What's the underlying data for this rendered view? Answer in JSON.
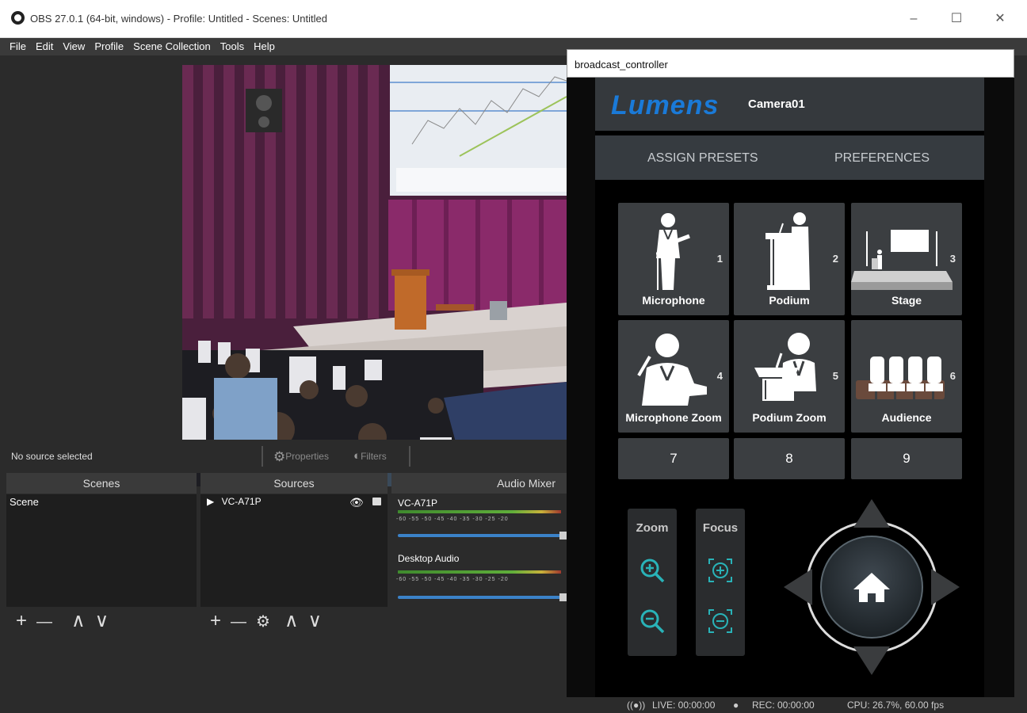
{
  "obs": {
    "title": "OBS 27.0.1 (64-bit, windows) - Profile: Untitled - Scenes: Untitled",
    "window_controls": {
      "minimize": "–",
      "maximize": "☐",
      "close": "✕"
    },
    "menu": [
      "File",
      "Edit",
      "View",
      "Profile",
      "Scene Collection",
      "Tools",
      "Help"
    ],
    "no_source": "No source selected",
    "properties": "Properties",
    "filters": "Filters",
    "docks": {
      "scenes": {
        "header": "Scenes",
        "items": [
          "Scene"
        ]
      },
      "sources": {
        "header": "Sources",
        "items": [
          "VC-A71P"
        ]
      },
      "mixer": {
        "header": "Audio Mixer",
        "channels": [
          {
            "name": "VC-A71P"
          },
          {
            "name": "Desktop Audio"
          }
        ],
        "scale": "-60 -55 -50 -45 -40 -35 -30 -25 -20"
      }
    },
    "footer_controls": {
      "add": "+",
      "remove": "—",
      "up": "∧",
      "down": "∨",
      "settings": "⚙"
    },
    "status": {
      "live": "LIVE: 00:00:00",
      "rec": "REC: 00:00:00",
      "cpu": "CPU: 26.7%, 60.00 fps"
    }
  },
  "controller": {
    "window_title": "broadcast_controller",
    "brand": "Lumens",
    "camera": "Camera01",
    "tabs": [
      "ASSIGN PRESETS",
      "PREFERENCES"
    ],
    "presets": [
      {
        "label": "Microphone",
        "number": "1",
        "icon": "microphone-speaker-icon"
      },
      {
        "label": "Podium",
        "number": "2",
        "icon": "podium-speaker-icon"
      },
      {
        "label": "Stage",
        "number": "3",
        "icon": "stage-icon"
      },
      {
        "label": "Microphone Zoom",
        "number": "4",
        "icon": "microphone-zoom-icon"
      },
      {
        "label": "Podium Zoom",
        "number": "5",
        "icon": "podium-zoom-icon"
      },
      {
        "label": "Audience",
        "number": "6",
        "icon": "audience-icon"
      }
    ],
    "extra_presets": [
      "7",
      "8",
      "9"
    ],
    "zoom_label": "Zoom",
    "focus_label": "Focus",
    "colors": {
      "brand_blue": "#1a7ad8",
      "accent_teal": "#29b3b8"
    }
  }
}
